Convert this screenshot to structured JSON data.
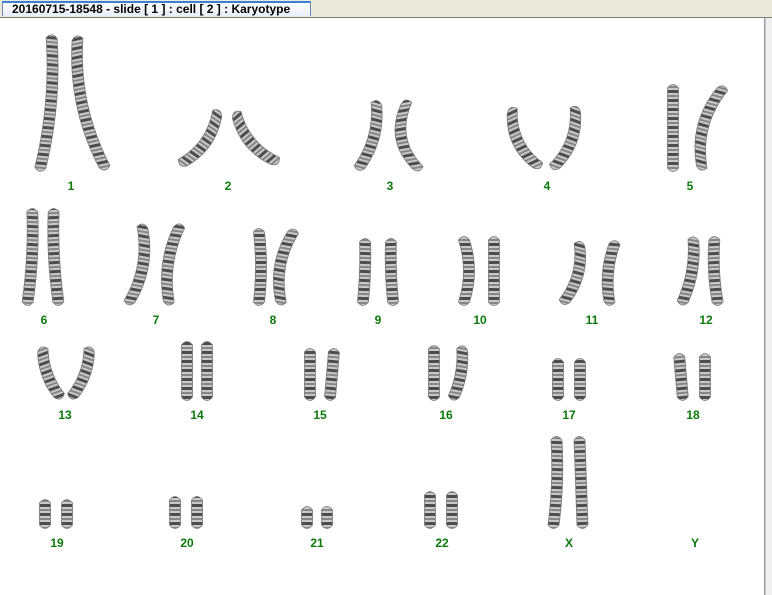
{
  "window": {
    "tab_title": "20160715-18548 - slide [ 1 ] : cell [ 2 ] : Karyotype"
  },
  "karyotype": {
    "chromosomes": [
      {
        "label": "1",
        "count": 2
      },
      {
        "label": "2",
        "count": 2
      },
      {
        "label": "3",
        "count": 2
      },
      {
        "label": "4",
        "count": 2
      },
      {
        "label": "5",
        "count": 2
      },
      {
        "label": "6",
        "count": 2
      },
      {
        "label": "7",
        "count": 2
      },
      {
        "label": "8",
        "count": 2
      },
      {
        "label": "9",
        "count": 2
      },
      {
        "label": "10",
        "count": 2
      },
      {
        "label": "11",
        "count": 2
      },
      {
        "label": "12",
        "count": 2
      },
      {
        "label": "13",
        "count": 2
      },
      {
        "label": "14",
        "count": 2
      },
      {
        "label": "15",
        "count": 2
      },
      {
        "label": "16",
        "count": 2
      },
      {
        "label": "17",
        "count": 2
      },
      {
        "label": "18",
        "count": 2
      },
      {
        "label": "19",
        "count": 2
      },
      {
        "label": "20",
        "count": 2
      },
      {
        "label": "21",
        "count": 2
      },
      {
        "label": "22",
        "count": 2
      },
      {
        "label": "X",
        "count": 2
      },
      {
        "label": "Y",
        "count": 0
      }
    ]
  },
  "colors": {
    "label_green": "#0a7a0a",
    "chromosome_dark": "#2a2a2a",
    "chromosome_light": "#bdbdbd",
    "tab_accent": "#3c7fd8"
  }
}
